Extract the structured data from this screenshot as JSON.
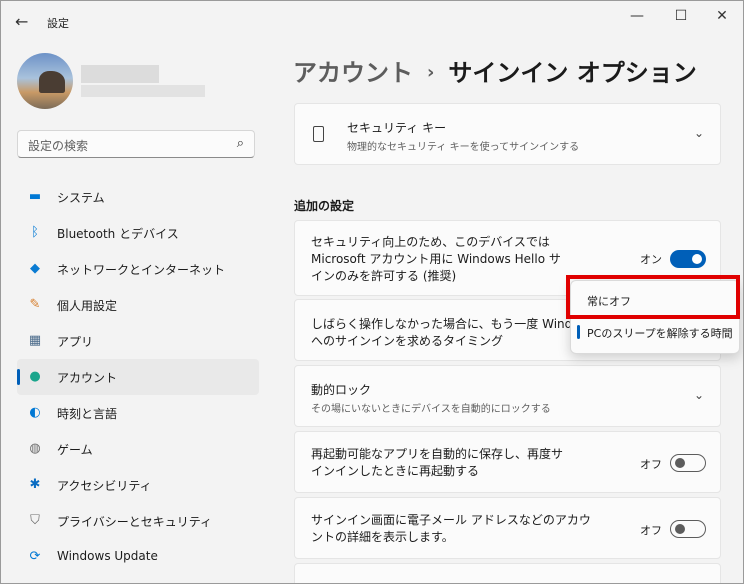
{
  "window": {
    "title": "設定",
    "controls": {
      "minimize": "—",
      "maximize": "☐",
      "close": "✕"
    }
  },
  "search": {
    "placeholder": "設定の検索"
  },
  "nav": [
    {
      "label": "システム",
      "icon": "monitor-icon",
      "color": "#0078d4",
      "active": false
    },
    {
      "label": "Bluetooth とデバイス",
      "icon": "bluetooth-icon",
      "color": "#0078d4",
      "active": false
    },
    {
      "label": "ネットワークとインターネット",
      "icon": "wifi-icon",
      "color": "#0a7bd2",
      "active": false
    },
    {
      "label": "個人用設定",
      "icon": "brush-icon",
      "color": "#d67d2a",
      "active": false
    },
    {
      "label": "アプリ",
      "icon": "apps-icon",
      "color": "#4a6a8a",
      "active": false
    },
    {
      "label": "アカウント",
      "icon": "account-icon",
      "color": "#1aa58c",
      "active": true
    },
    {
      "label": "時刻と言語",
      "icon": "globe-clock-icon",
      "color": "#0078d4",
      "active": false
    },
    {
      "label": "ゲーム",
      "icon": "gamepad-icon",
      "color": "#6b6b6b",
      "active": false
    },
    {
      "label": "アクセシビリティ",
      "icon": "accessibility-icon",
      "color": "#0a6cc2",
      "active": false
    },
    {
      "label": "プライバシーとセキュリティ",
      "icon": "shield-icon",
      "color": "#6b6b6b",
      "active": false
    },
    {
      "label": "Windows Update",
      "icon": "update-icon",
      "color": "#0078d4",
      "active": false
    }
  ],
  "breadcrumb": {
    "parent": "アカウント",
    "separator": "›",
    "current": "サインイン オプション"
  },
  "security_key": {
    "title": "セキュリティ キー",
    "subtitle": "物理的なセキュリティ キーを使ってサインインする"
  },
  "additional_settings": {
    "heading": "追加の設定"
  },
  "hello_only": {
    "line1": "セキュリティ向上のため、このデバイスでは",
    "line2": "Microsoft アカウント用に Windows Hello サ",
    "line3": "インのみを許可する (推奨)",
    "state_label": "オン",
    "on": true
  },
  "require_signin": {
    "line1": "しばらく操作しなかった場合に、もう一度 Windows",
    "line2": "へのサインインを求めるタイミング"
  },
  "dropdown": {
    "options": [
      "常にオフ",
      "PCのスリープを解除する時間"
    ],
    "selected_index": 1,
    "highlighted_index": 0
  },
  "dynamic_lock": {
    "title": "動的ロック",
    "subtitle": "その場にいないときにデバイスを自動的にロックする"
  },
  "restart_apps": {
    "line1": "再起動可能なアプリを自動的に保存し、再度サ",
    "line2": "インインしたときに再起動する",
    "state_label": "オフ",
    "on": false
  },
  "show_account": {
    "line1": "サインイン画面に電子メール アドレスなどのアカウ",
    "line2": "ントの詳細を表示します。",
    "state_label": "オフ",
    "on": false
  },
  "accent_color": "#005fb8",
  "highlight_color": "#e00000"
}
